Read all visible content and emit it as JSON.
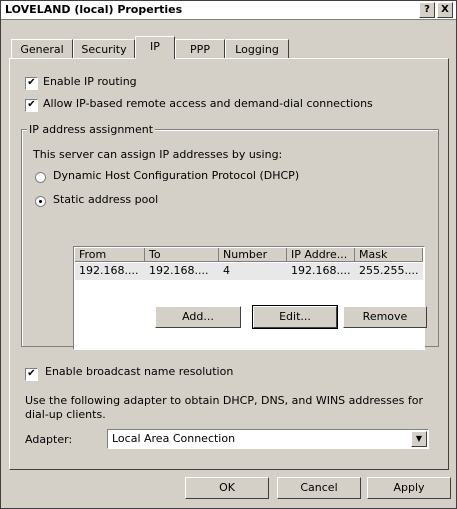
{
  "window": {
    "title": "LOVELAND (local) Properties",
    "help_glyph": "?",
    "close_glyph": "X"
  },
  "tabs": [
    "General",
    "Security",
    "IP",
    "PPP",
    "Logging"
  ],
  "active_tab": "IP",
  "ip": {
    "enable_ip_routing": {
      "label": "Enable IP routing",
      "checked": true,
      "mark": "✔"
    },
    "allow_remote": {
      "label": "Allow IP-based remote access and demand-dial connections",
      "checked": true,
      "mark": "✔"
    },
    "group_title": "IP address assignment",
    "assign_text": "This server can assign IP addresses by using:",
    "dhcp_option": {
      "label": "Dynamic Host Configuration Protocol (DHCP)",
      "selected": false
    },
    "static_option": {
      "label": "Static address pool",
      "selected": true
    },
    "pool_table": {
      "headers": [
        "From",
        "To",
        "Number",
        "IP Addre...",
        "Mask"
      ],
      "rows": [
        [
          "192.168....",
          "192.168....",
          "4",
          "192.168....",
          "255.255...."
        ]
      ]
    },
    "add_button": "Add...",
    "edit_button": "Edit...",
    "remove_button": "Remove",
    "broadcast": {
      "label": "Enable broadcast name resolution",
      "checked": true,
      "mark": "✔"
    },
    "adapter_text": "Use the following adapter to obtain DHCP, DNS, and WINS addresses for dial-up clients.",
    "adapter_label": "Adapter:",
    "adapter_value": "Local Area Connection",
    "adapter_arrow": "▼"
  },
  "footer": {
    "ok": "OK",
    "cancel": "Cancel",
    "apply": "Apply"
  },
  "colors": {
    "face": "#d4d0c8",
    "shadow": "#808080",
    "dark": "#404040",
    "highlight": "#ffffff",
    "selected_row": "#e8e8e8"
  }
}
